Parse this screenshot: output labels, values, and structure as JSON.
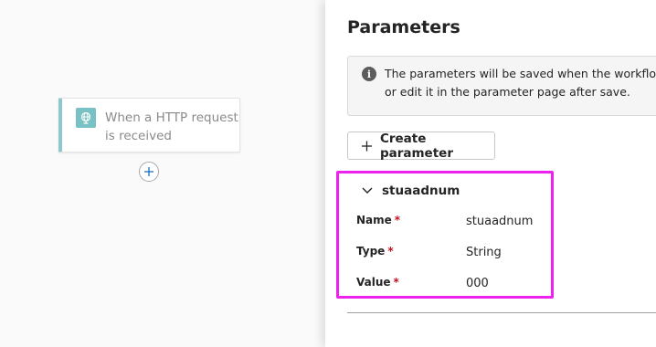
{
  "canvas": {
    "trigger": {
      "label": "When a HTTP request is received",
      "icon": "globe-icon",
      "accent_color": "#78c1c4"
    },
    "add_step_icon": "plus-icon"
  },
  "panel": {
    "title": "Parameters",
    "info": {
      "icon": "info-icon",
      "line1": "The parameters will be saved when the workflow is s",
      "line2": "or edit it in the parameter page after save."
    },
    "create_button": {
      "icon": "plus-icon",
      "label": "Create parameter"
    },
    "parameter": {
      "name": "stuaadnum",
      "expanded": true,
      "fields": [
        {
          "label": "Name",
          "required": "*",
          "value": "stuaadnum"
        },
        {
          "label": "Type",
          "required": "*",
          "value": "String"
        },
        {
          "label": "Value",
          "required": "*",
          "value": "000"
        }
      ]
    },
    "highlight_color": "#ee22ee"
  }
}
